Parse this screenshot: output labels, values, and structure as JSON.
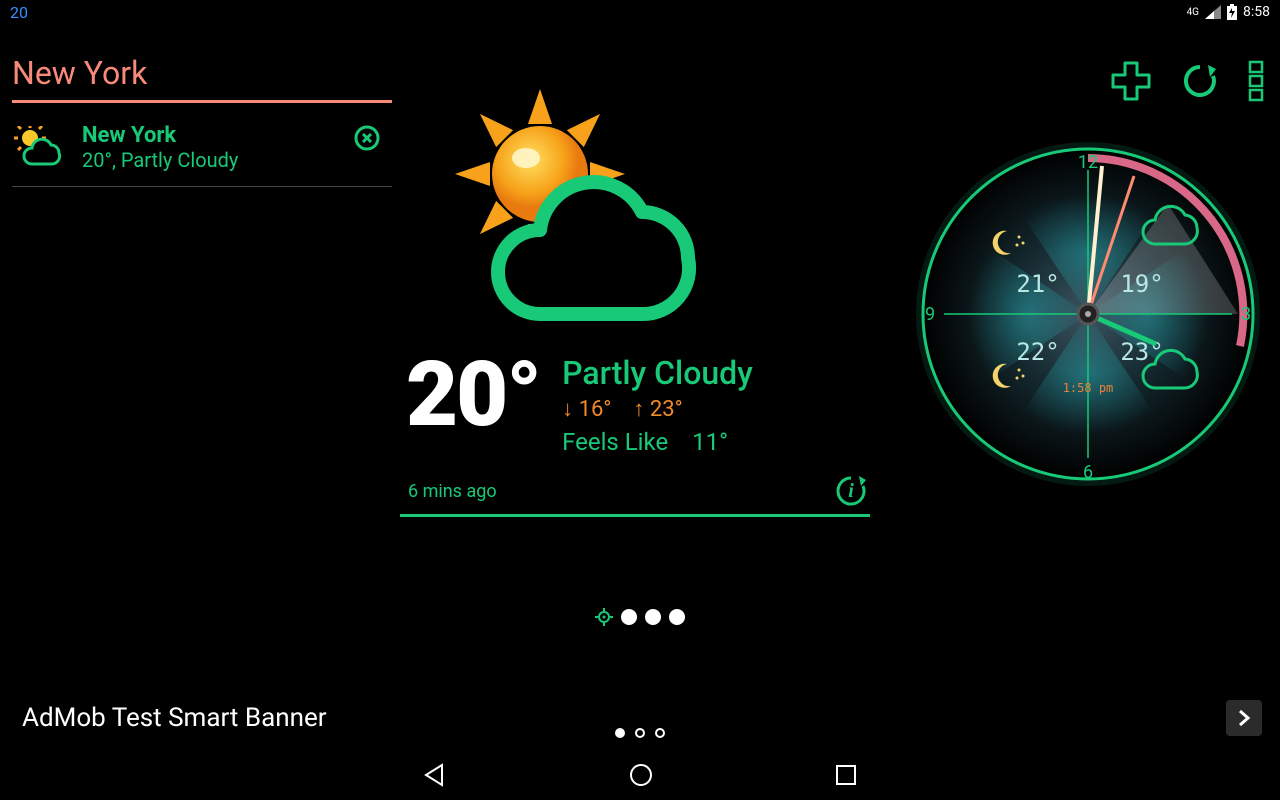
{
  "status": {
    "left": "20",
    "network": "4G",
    "time": "8:58"
  },
  "sidebar": {
    "title": "New York",
    "items": [
      {
        "name": "New York",
        "temp": "20°",
        "condition": "Partly Cloudy"
      }
    ]
  },
  "toolbar": {
    "add": "add",
    "refresh": "refresh",
    "menu": "menu"
  },
  "weather": {
    "temp": "20°",
    "condition": "Partly Cloudy",
    "low_arrow": "↓",
    "low": "16°",
    "high_arrow": "↑",
    "high": "23°",
    "feels_label": "Feels Like",
    "feels_value": "11°",
    "updated": "6 mins ago"
  },
  "clock": {
    "top_left_temp": "21°",
    "top_right_temp": "19°",
    "bottom_left_temp": "22°",
    "bottom_right_temp": "23°",
    "time_label": "1:58 pm",
    "h12": "12",
    "h3": "3",
    "h6": "6",
    "h9": "9"
  },
  "banner": {
    "text": "AdMob Test Smart Banner"
  }
}
